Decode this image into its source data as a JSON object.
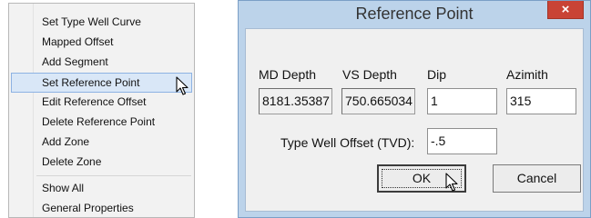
{
  "context_menu": {
    "items": [
      {
        "label": "Set Type Well Curve"
      },
      {
        "label": "Mapped Offset"
      },
      {
        "label": "Add Segment"
      },
      {
        "label": "Set Reference Point"
      },
      {
        "label": "Edit Reference Offset"
      },
      {
        "label": "Delete Reference Point"
      },
      {
        "label": "Add Zone"
      },
      {
        "label": "Delete Zone"
      },
      {
        "label": "Show All"
      },
      {
        "label": "General Properties"
      }
    ],
    "highlighted_item": "Set Reference Point"
  },
  "dialog": {
    "title": "Reference Point",
    "close_label": "×",
    "fields": {
      "md_depth": {
        "label": "MD Depth",
        "value": "8181.35387"
      },
      "vs_depth": {
        "label": "VS Depth",
        "value": "750.665034"
      },
      "dip": {
        "label": "Dip",
        "value": "1"
      },
      "azimuth": {
        "label": "Azimith",
        "value": "315"
      },
      "type_well_offset": {
        "label": "Type Well Offset (TVD):",
        "value": "-.5"
      }
    },
    "buttons": {
      "ok": "OK",
      "cancel": "Cancel"
    }
  },
  "colors": {
    "menu_highlight": "#d9e7f7",
    "dialog_frame": "#bcd3ea",
    "close_button": "#c94335"
  }
}
